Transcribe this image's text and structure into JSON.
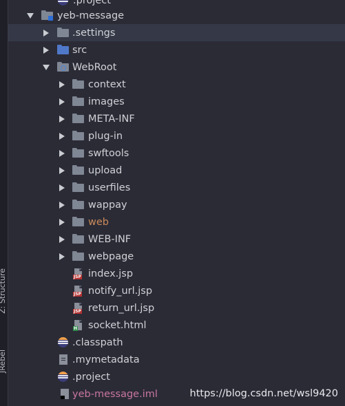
{
  "sidebar": {
    "structure_label": "Z: Structure",
    "jrebel_label": "JRebel"
  },
  "tree": {
    "top_partial_label": ".project",
    "root": "yeb-message",
    "items": [
      {
        "label": ".settings",
        "type": "folder"
      },
      {
        "label": "src",
        "type": "folder-blue"
      },
      {
        "label": "WebRoot",
        "type": "folder-web"
      },
      {
        "label": "context",
        "type": "folder"
      },
      {
        "label": "images",
        "type": "folder"
      },
      {
        "label": "META-INF",
        "type": "folder"
      },
      {
        "label": "plug-in",
        "type": "folder"
      },
      {
        "label": "swftools",
        "type": "folder"
      },
      {
        "label": "upload",
        "type": "folder"
      },
      {
        "label": "userfiles",
        "type": "folder"
      },
      {
        "label": "wappay",
        "type": "folder"
      },
      {
        "label": "web",
        "type": "folder"
      },
      {
        "label": "WEB-INF",
        "type": "folder"
      },
      {
        "label": "webpage",
        "type": "folder"
      },
      {
        "label": "index.jsp",
        "type": "jsp"
      },
      {
        "label": "notify_url.jsp",
        "type": "jsp"
      },
      {
        "label": "return_url.jsp",
        "type": "jsp"
      },
      {
        "label": "socket.html",
        "type": "html"
      },
      {
        "label": ".classpath",
        "type": "eclipse"
      },
      {
        "label": ".mymetadata",
        "type": "metadata"
      },
      {
        "label": ".project",
        "type": "eclipse"
      },
      {
        "label": "yeb-message.iml",
        "type": "iml"
      }
    ],
    "file_tags": {
      "jsp": "JSP",
      "html": "H"
    }
  },
  "colors": {
    "background": "#2b2b36",
    "text": "#cfd2d6",
    "selected_row": "#353947",
    "web_folder_text": "#c98b5a",
    "iml_text": "#c9769e"
  },
  "watermark": "https://blog.csdn.net/wsl9420"
}
